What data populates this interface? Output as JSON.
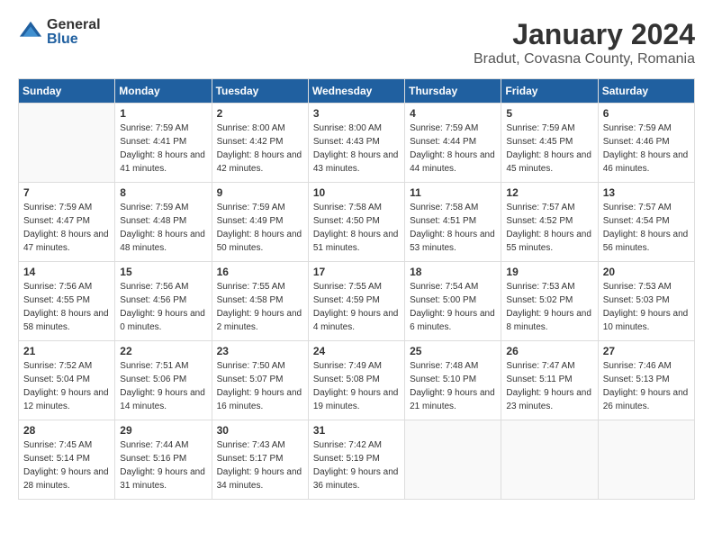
{
  "header": {
    "logo_general": "General",
    "logo_blue": "Blue",
    "month_title": "January 2024",
    "location": "Bradut, Covasna County, Romania"
  },
  "weekdays": [
    "Sunday",
    "Monday",
    "Tuesday",
    "Wednesday",
    "Thursday",
    "Friday",
    "Saturday"
  ],
  "weeks": [
    [
      {
        "day": "",
        "sunrise": "",
        "sunset": "",
        "daylight": ""
      },
      {
        "day": "1",
        "sunrise": "Sunrise: 7:59 AM",
        "sunset": "Sunset: 4:41 PM",
        "daylight": "Daylight: 8 hours and 41 minutes."
      },
      {
        "day": "2",
        "sunrise": "Sunrise: 8:00 AM",
        "sunset": "Sunset: 4:42 PM",
        "daylight": "Daylight: 8 hours and 42 minutes."
      },
      {
        "day": "3",
        "sunrise": "Sunrise: 8:00 AM",
        "sunset": "Sunset: 4:43 PM",
        "daylight": "Daylight: 8 hours and 43 minutes."
      },
      {
        "day": "4",
        "sunrise": "Sunrise: 7:59 AM",
        "sunset": "Sunset: 4:44 PM",
        "daylight": "Daylight: 8 hours and 44 minutes."
      },
      {
        "day": "5",
        "sunrise": "Sunrise: 7:59 AM",
        "sunset": "Sunset: 4:45 PM",
        "daylight": "Daylight: 8 hours and 45 minutes."
      },
      {
        "day": "6",
        "sunrise": "Sunrise: 7:59 AM",
        "sunset": "Sunset: 4:46 PM",
        "daylight": "Daylight: 8 hours and 46 minutes."
      }
    ],
    [
      {
        "day": "7",
        "sunrise": "Sunrise: 7:59 AM",
        "sunset": "Sunset: 4:47 PM",
        "daylight": "Daylight: 8 hours and 47 minutes."
      },
      {
        "day": "8",
        "sunrise": "Sunrise: 7:59 AM",
        "sunset": "Sunset: 4:48 PM",
        "daylight": "Daylight: 8 hours and 48 minutes."
      },
      {
        "day": "9",
        "sunrise": "Sunrise: 7:59 AM",
        "sunset": "Sunset: 4:49 PM",
        "daylight": "Daylight: 8 hours and 50 minutes."
      },
      {
        "day": "10",
        "sunrise": "Sunrise: 7:58 AM",
        "sunset": "Sunset: 4:50 PM",
        "daylight": "Daylight: 8 hours and 51 minutes."
      },
      {
        "day": "11",
        "sunrise": "Sunrise: 7:58 AM",
        "sunset": "Sunset: 4:51 PM",
        "daylight": "Daylight: 8 hours and 53 minutes."
      },
      {
        "day": "12",
        "sunrise": "Sunrise: 7:57 AM",
        "sunset": "Sunset: 4:52 PM",
        "daylight": "Daylight: 8 hours and 55 minutes."
      },
      {
        "day": "13",
        "sunrise": "Sunrise: 7:57 AM",
        "sunset": "Sunset: 4:54 PM",
        "daylight": "Daylight: 8 hours and 56 minutes."
      }
    ],
    [
      {
        "day": "14",
        "sunrise": "Sunrise: 7:56 AM",
        "sunset": "Sunset: 4:55 PM",
        "daylight": "Daylight: 8 hours and 58 minutes."
      },
      {
        "day": "15",
        "sunrise": "Sunrise: 7:56 AM",
        "sunset": "Sunset: 4:56 PM",
        "daylight": "Daylight: 9 hours and 0 minutes."
      },
      {
        "day": "16",
        "sunrise": "Sunrise: 7:55 AM",
        "sunset": "Sunset: 4:58 PM",
        "daylight": "Daylight: 9 hours and 2 minutes."
      },
      {
        "day": "17",
        "sunrise": "Sunrise: 7:55 AM",
        "sunset": "Sunset: 4:59 PM",
        "daylight": "Daylight: 9 hours and 4 minutes."
      },
      {
        "day": "18",
        "sunrise": "Sunrise: 7:54 AM",
        "sunset": "Sunset: 5:00 PM",
        "daylight": "Daylight: 9 hours and 6 minutes."
      },
      {
        "day": "19",
        "sunrise": "Sunrise: 7:53 AM",
        "sunset": "Sunset: 5:02 PM",
        "daylight": "Daylight: 9 hours and 8 minutes."
      },
      {
        "day": "20",
        "sunrise": "Sunrise: 7:53 AM",
        "sunset": "Sunset: 5:03 PM",
        "daylight": "Daylight: 9 hours and 10 minutes."
      }
    ],
    [
      {
        "day": "21",
        "sunrise": "Sunrise: 7:52 AM",
        "sunset": "Sunset: 5:04 PM",
        "daylight": "Daylight: 9 hours and 12 minutes."
      },
      {
        "day": "22",
        "sunrise": "Sunrise: 7:51 AM",
        "sunset": "Sunset: 5:06 PM",
        "daylight": "Daylight: 9 hours and 14 minutes."
      },
      {
        "day": "23",
        "sunrise": "Sunrise: 7:50 AM",
        "sunset": "Sunset: 5:07 PM",
        "daylight": "Daylight: 9 hours and 16 minutes."
      },
      {
        "day": "24",
        "sunrise": "Sunrise: 7:49 AM",
        "sunset": "Sunset: 5:08 PM",
        "daylight": "Daylight: 9 hours and 19 minutes."
      },
      {
        "day": "25",
        "sunrise": "Sunrise: 7:48 AM",
        "sunset": "Sunset: 5:10 PM",
        "daylight": "Daylight: 9 hours and 21 minutes."
      },
      {
        "day": "26",
        "sunrise": "Sunrise: 7:47 AM",
        "sunset": "Sunset: 5:11 PM",
        "daylight": "Daylight: 9 hours and 23 minutes."
      },
      {
        "day": "27",
        "sunrise": "Sunrise: 7:46 AM",
        "sunset": "Sunset: 5:13 PM",
        "daylight": "Daylight: 9 hours and 26 minutes."
      }
    ],
    [
      {
        "day": "28",
        "sunrise": "Sunrise: 7:45 AM",
        "sunset": "Sunset: 5:14 PM",
        "daylight": "Daylight: 9 hours and 28 minutes."
      },
      {
        "day": "29",
        "sunrise": "Sunrise: 7:44 AM",
        "sunset": "Sunset: 5:16 PM",
        "daylight": "Daylight: 9 hours and 31 minutes."
      },
      {
        "day": "30",
        "sunrise": "Sunrise: 7:43 AM",
        "sunset": "Sunset: 5:17 PM",
        "daylight": "Daylight: 9 hours and 34 minutes."
      },
      {
        "day": "31",
        "sunrise": "Sunrise: 7:42 AM",
        "sunset": "Sunset: 5:19 PM",
        "daylight": "Daylight: 9 hours and 36 minutes."
      },
      {
        "day": "",
        "sunrise": "",
        "sunset": "",
        "daylight": ""
      },
      {
        "day": "",
        "sunrise": "",
        "sunset": "",
        "daylight": ""
      },
      {
        "day": "",
        "sunrise": "",
        "sunset": "",
        "daylight": ""
      }
    ]
  ]
}
